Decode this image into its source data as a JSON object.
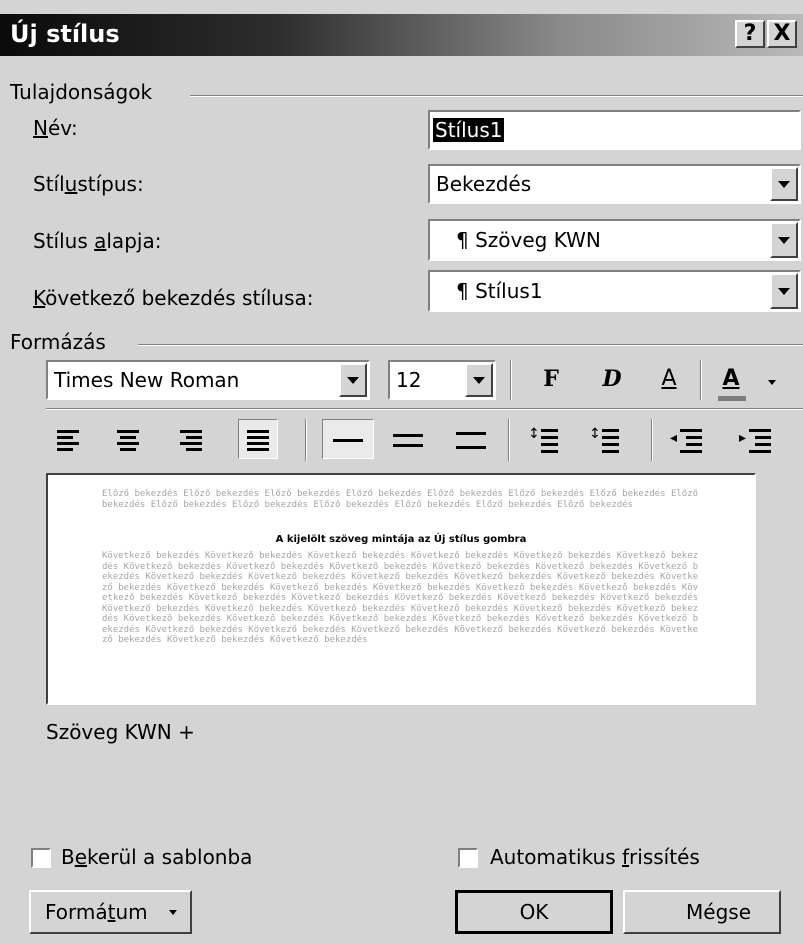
{
  "dialog": {
    "title": "Új stílus",
    "help_label": "?",
    "close_label": "X"
  },
  "properties": {
    "group_label": "Tulajdonságok",
    "name": {
      "pre": "",
      "ul": "N",
      "post": "év:",
      "value": "Stílus1"
    },
    "style_type": {
      "pre": "Stíl",
      "ul": "u",
      "post": "stípus:",
      "value": "Bekezdés"
    },
    "based_on": {
      "pre": "Stílus ",
      "ul": "a",
      "post": "lapja:",
      "value": "¶ Szöveg KWN"
    },
    "next_style": {
      "pre": "",
      "ul": "K",
      "post": "övetkező bekezdés stílusa:",
      "value": "¶ Stílus1"
    }
  },
  "formatting": {
    "group_label": "Formázás",
    "font": "Times New Roman",
    "size": "12",
    "bold_label": "F",
    "italic_label": "D",
    "underline_label": "A",
    "font_color_label": "A"
  },
  "preview": {
    "prev_text": "Előző bekezdés Előző bekezdés Előző bekezdés Előző bekezdés Előző bekezdés Előző bekezdés Előző bekezdés Előző bekezdés Előző bekezdés Előző bekezdés Előző bekezdés Előző bekezdés Előző bekezdés Előző bekezdés",
    "sample_text": "A kijelölt szöveg mintája az Új stílus gombra",
    "next_text": "Következő bekezdés Következő bekezdés Következő bekezdés Következő bekezdés Következő bekezdés Következő bekezdés Következő bekezdés Következő bekezdés Következő bekezdés Következő bekezdés Következő bekezdés Következő bekezdés Következő bekezdés Következő bekezdés Következő bekezdés Következő bekezdés Következő bekezdés Következő bekezdés Következő bekezdés Következő bekezdés Következő bekezdés Következő bekezdés Következő bekezdés Következő bekezdés Következő bekezdés Következő bekezdés Következő bekezdés Következő bekezdés Következő bekezdés Következő bekezdés Következő bekezdés Következő bekezdés Következő bekezdés Következő bekezdés Következő bekezdés Következő bekezdés Következő bekezdés Következő bekezdés Következő bekezdés Következő bekezdés Következő bekezdés Következő bekezdés Következő bekezdés Következő bekezdés Következő bekezdés Következő bekezdés Következő bekezdés Következő bekezdés Következő bekezdés"
  },
  "description": "Szöveg KWN +",
  "options": {
    "add_to_template": {
      "pre": "B",
      "ul": "e",
      "post": "kerül a sablonba",
      "checked": false
    },
    "auto_update": {
      "pre": "Automatikus ",
      "ul": "f",
      "post": "rissítés",
      "checked": false
    }
  },
  "buttons": {
    "format": {
      "pre": "Formá",
      "ul": "t",
      "post": "um"
    },
    "ok": "OK",
    "cancel": "Mégse"
  }
}
